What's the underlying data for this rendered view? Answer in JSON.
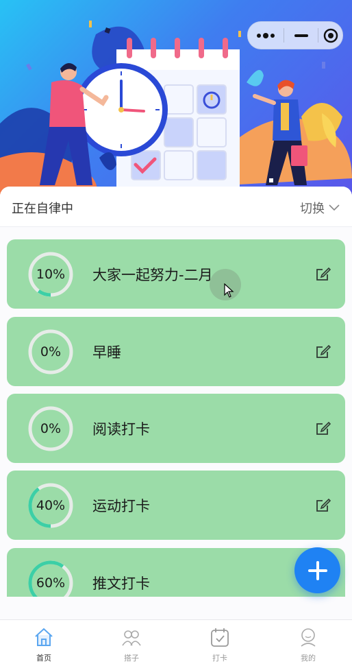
{
  "capsule": {
    "more_icon": "more-dots-icon",
    "minimize_icon": "minimize-icon",
    "close_icon": "target-icon"
  },
  "header": {
    "title": "正在自律中",
    "switch_label": "切换"
  },
  "tasks": [
    {
      "name": "大家一起努力-二月",
      "progress_label": "10%",
      "progress": 0.1
    },
    {
      "name": "早睡",
      "progress_label": "0%",
      "progress": 0.0
    },
    {
      "name": "阅读打卡",
      "progress_label": "0%",
      "progress": 0.0
    },
    {
      "name": "运动打卡",
      "progress_label": "40%",
      "progress": 0.4
    },
    {
      "name": "推文打卡",
      "progress_label": "60%",
      "progress": 0.6
    }
  ],
  "fab": {
    "icon": "plus-icon"
  },
  "tabbar": {
    "items": [
      {
        "label": "首页",
        "icon": "home-icon"
      },
      {
        "label": "搭子",
        "icon": "buddies-icon"
      },
      {
        "label": "打卡",
        "icon": "checkin-calendar-icon"
      },
      {
        "label": "我的",
        "icon": "profile-icon"
      }
    ]
  },
  "colors": {
    "card": "#9bdca8",
    "ring_track": "#e6ece8",
    "ring_progress": "#3ccfa6",
    "accent": "#1f82f3",
    "active_tab": "#5aa6f0"
  }
}
